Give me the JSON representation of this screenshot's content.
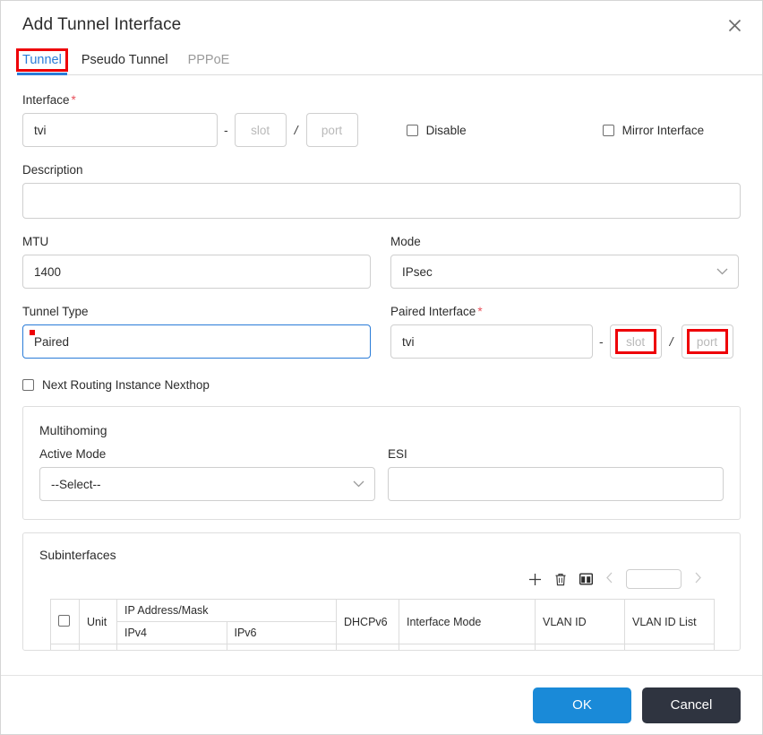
{
  "dialog": {
    "title": "Add Tunnel Interface",
    "close_icon": "close-icon"
  },
  "tabs": [
    {
      "label": "Tunnel",
      "state": "active",
      "annotated": true
    },
    {
      "label": "Pseudo Tunnel",
      "state": "normal",
      "annotated": false
    },
    {
      "label": "PPPoE",
      "state": "muted",
      "annotated": false
    }
  ],
  "form": {
    "interface": {
      "label": "Interface",
      "required": "*",
      "value": "tvi",
      "slot_placeholder": "slot",
      "port_placeholder": "port",
      "separator": "-",
      "slash": "/"
    },
    "disable": {
      "label": "Disable",
      "checked": false
    },
    "mirror_interface": {
      "label": "Mirror Interface",
      "checked": false
    },
    "description": {
      "label": "Description",
      "value": "",
      "placeholder": ""
    },
    "mtu": {
      "label": "MTU",
      "value": "1400"
    },
    "mode": {
      "label": "Mode",
      "value": "IPsec",
      "chevron": "chevron-down-icon"
    },
    "tunnel_type": {
      "label": "Tunnel Type",
      "value": "Paired",
      "focused": true,
      "annotated": true
    },
    "paired_interface": {
      "label": "Paired Interface",
      "required": "*",
      "value": "tvi",
      "slot_placeholder": "slot",
      "port_placeholder": "port",
      "separator": "-",
      "slash": "/",
      "slot_annotated": true,
      "port_annotated": true
    },
    "next_routing_instance_nexthop": {
      "label": "Next Routing Instance Nexthop",
      "checked": false
    }
  },
  "multihoming": {
    "title": "Multihoming",
    "active_mode": {
      "label": "Active Mode",
      "value": "--Select--"
    },
    "esi": {
      "label": "ESI",
      "value": ""
    }
  },
  "subinterfaces": {
    "title": "Subinterfaces",
    "toolbar": {
      "add_icon": "plus-icon",
      "delete_icon": "trash-icon",
      "columns_icon": "column-settings-icon",
      "prev_icon": "chevron-left-icon",
      "next_icon": "chevron-right-icon",
      "page_value": ""
    },
    "table": {
      "group_header": "IP Address/Mask",
      "columns": [
        "Unit",
        "IPv4",
        "IPv6",
        "DHCPv6",
        "Interface Mode",
        "VLAN ID",
        "VLAN ID List"
      ],
      "rows": []
    }
  },
  "footer": {
    "ok_label": "OK",
    "cancel_label": "Cancel"
  },
  "colors": {
    "accent_blue": "#2a7cd8",
    "ok_blue": "#1a8ad8",
    "cancel_dark": "#2f3440",
    "annotation_red": "#ee0007",
    "required_red": "#e8505b"
  }
}
